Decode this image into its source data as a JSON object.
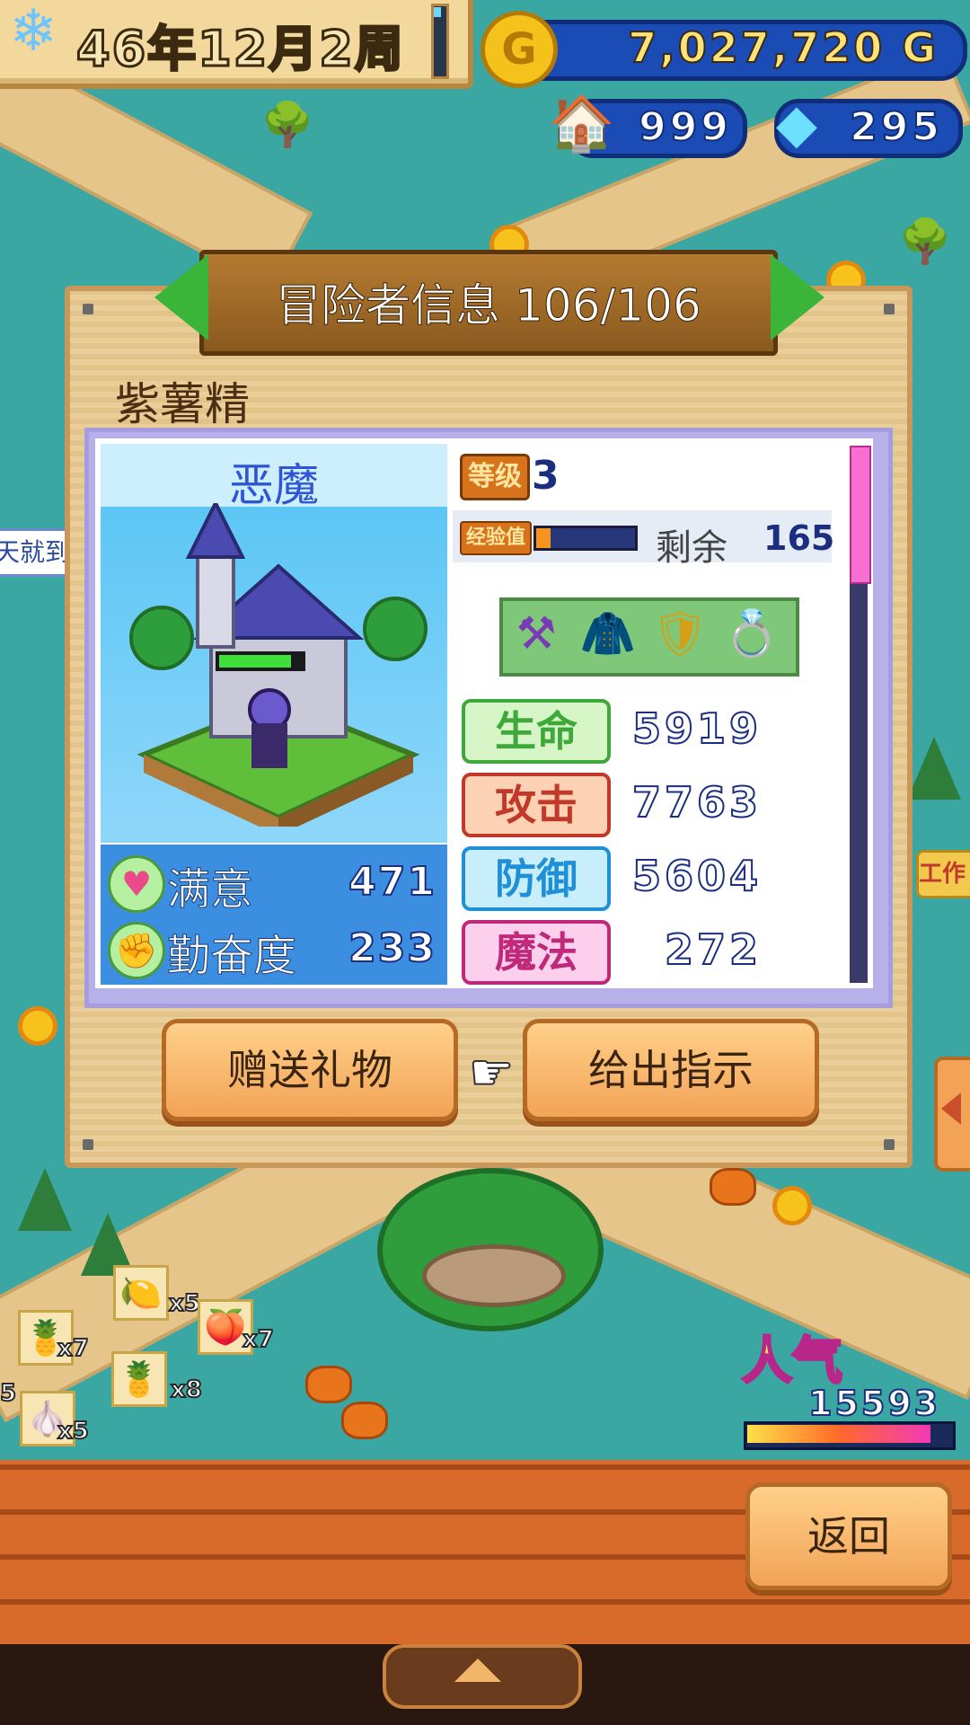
{
  "hud": {
    "date": "46年12月2周",
    "date_progress": 0.15,
    "gold": "7,027,720 G",
    "gold_icon": "G",
    "houses": "999",
    "crystals": "295"
  },
  "dialog": {
    "title": "冒险者信息 106/106",
    "adventurer_name": "紫薯精",
    "class_name": "恶魔",
    "level_label": "等级",
    "level": "3",
    "exp_label": "经验值",
    "exp_progress": 0.15,
    "exp_remaining_label": "剩余",
    "exp_remaining": "165",
    "satisfaction_label": "满意",
    "satisfaction": "471",
    "diligence_label": "勤奋度",
    "diligence": "233",
    "stats": [
      {
        "label": "生命",
        "value": "5919",
        "color": "#3ea83a",
        "bg": "#d6f6c8"
      },
      {
        "label": "攻击",
        "value": "7763",
        "color": "#c0392b",
        "bg": "#fcd1b4"
      },
      {
        "label": "防御",
        "value": "5604",
        "color": "#1f8fd8",
        "bg": "#c8eefc"
      },
      {
        "label": "魔法",
        "value": "272",
        "color": "#c0287a",
        "bg": "#fcd0ec"
      }
    ],
    "equipment_icons": [
      "axe-icon",
      "cloak-icon",
      "shield-icon",
      "ring-icon"
    ],
    "gift_button": "赠送礼物",
    "instruct_button": "给出指示"
  },
  "map": {
    "popularity_label": "人气",
    "popularity": "15593",
    "popularity_progress": 0.92,
    "speech_bubble": "天就到",
    "work_label": "工作",
    "items": [
      {
        "icon": "🍋",
        "count": "x5"
      },
      {
        "icon": "🍍",
        "count": "x7"
      },
      {
        "icon": "🍑",
        "count": "x7"
      },
      {
        "icon": "🍍",
        "count": "x8"
      },
      {
        "icon": "🧄",
        "count": "x5"
      }
    ],
    "side_count": "5"
  },
  "footer": {
    "back_button": "返回"
  },
  "colors": {
    "accent_green": "#3bb43a",
    "panel_wood": "#e9c98e",
    "stat_text": "#1b2e80"
  }
}
